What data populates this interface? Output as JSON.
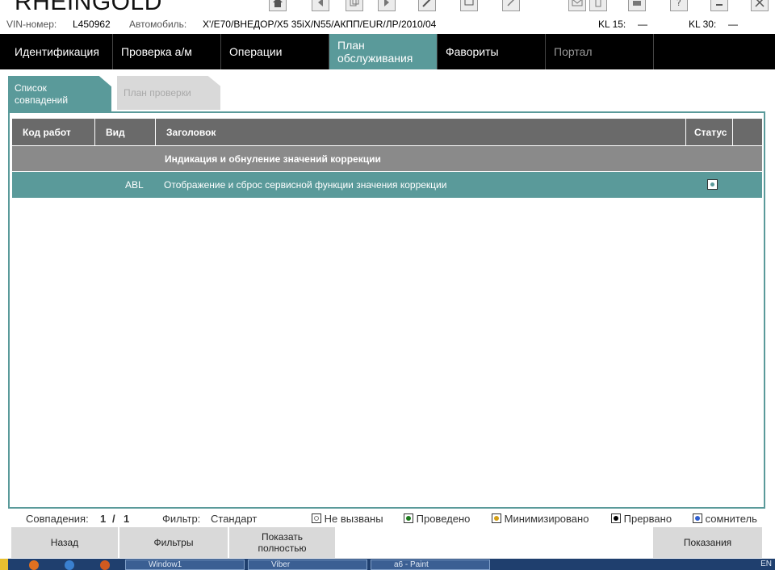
{
  "app": {
    "title": "RHEINGOLD"
  },
  "info": {
    "vin_label": "VIN-номер:",
    "vin_value": "L450962",
    "car_label": "Автомобиль:",
    "car_value": "X'/E70/ВНЕДОР/X5 35iX/N55/АКПП/EUR/ЛР/2010/04",
    "kl15_label": "KL 15:",
    "kl15_value": "—",
    "kl30_label": "KL 30:",
    "kl30_value": "—"
  },
  "nav": {
    "tabs": [
      {
        "label": "Идентификация"
      },
      {
        "label": "Проверка а/м"
      },
      {
        "label": "Операции"
      },
      {
        "label": "План обслуживания"
      },
      {
        "label": "Фавориты"
      },
      {
        "label": "Портал"
      }
    ]
  },
  "subtabs": [
    {
      "label": "Список совпадений"
    },
    {
      "label": "План проверки"
    }
  ],
  "table": {
    "columns": [
      "Код работ",
      "Вид",
      "Заголовок",
      "Статус"
    ],
    "group_title": "Индикация и обнуление значений коррекции",
    "rows": [
      {
        "code": "",
        "type": "ABL",
        "title": "Отображение и сброс сервисной функции значения коррекции"
      }
    ]
  },
  "status": {
    "matches_label": "Совпадения:",
    "matches_value": "1",
    "matches_sep": "/",
    "matches_total": "1",
    "filter_label": "Фильтр:",
    "filter_value": "Стандарт",
    "legend": [
      {
        "label": "Не вызваны",
        "color": "#ffffff"
      },
      {
        "label": "Проведено",
        "color": "#1e7b1e"
      },
      {
        "label": "Минимизировано",
        "color": "#d4a017"
      },
      {
        "label": "Прервано",
        "color": "#000000"
      },
      {
        "label": "сомнитель",
        "color": "#2f5fd0"
      }
    ]
  },
  "buttons": {
    "back": "Назад",
    "filters": "Фильтры",
    "show_full": "Показать полностью",
    "readings": "Показания"
  },
  "taskbar": {
    "items": [
      "Window1",
      "Viber",
      "a6 - Paint"
    ],
    "lang": "EN"
  }
}
